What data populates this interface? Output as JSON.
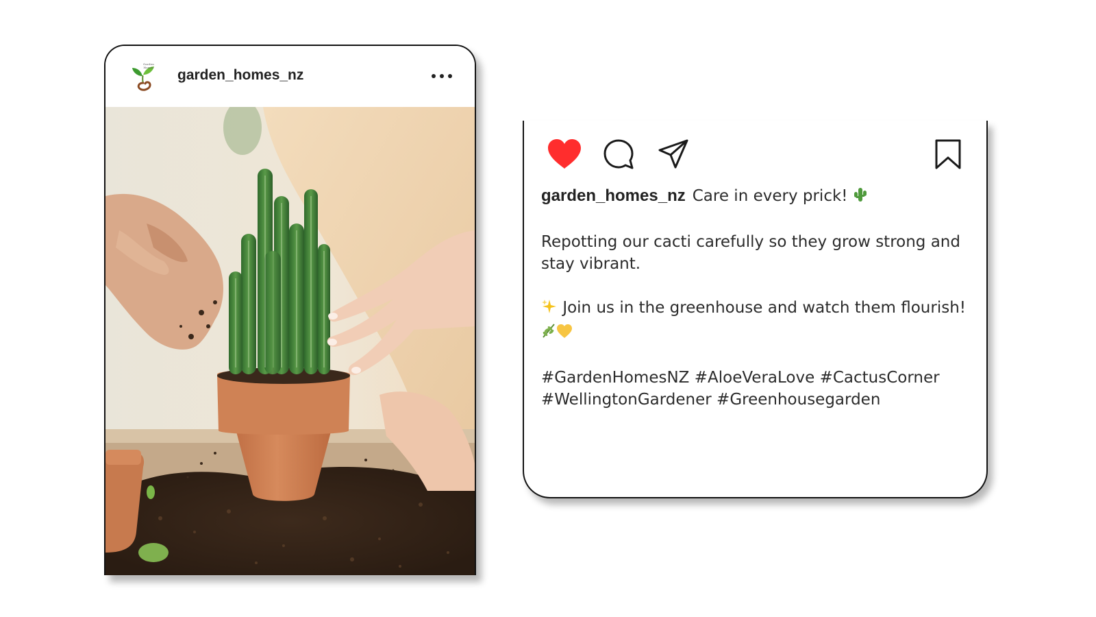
{
  "post": {
    "username": "garden_homes_nz",
    "logo_text": "Garden Homes",
    "photo_description": "Hands repotting a cactus in a terracotta pot with soil"
  },
  "caption": {
    "username": "garden_homes_nz",
    "headline": "Care in every prick!",
    "paragraph1": "Repotting our cacti carefully so they grow strong and stay vibrant.",
    "paragraph2": "Join us in the greenhouse and watch them flourish!",
    "hashtags_line1": "#GardenHomesNZ #AloeVeraLove #CactusCorner",
    "hashtags_line2": "#WellingtonGardener #Greenhousegarden"
  },
  "actions": {
    "like_icon": "heart-filled-icon",
    "comment_icon": "speech-bubble-icon",
    "share_icon": "paper-plane-icon",
    "save_icon": "bookmark-icon",
    "more_icon": "ellipsis-icon"
  },
  "colors": {
    "like": "#ff2d2d",
    "text": "#2b2b2b",
    "border": "#111111",
    "cactus": "#3f7a3a",
    "pot": "#c9784d",
    "soil": "#3a2a1e"
  }
}
